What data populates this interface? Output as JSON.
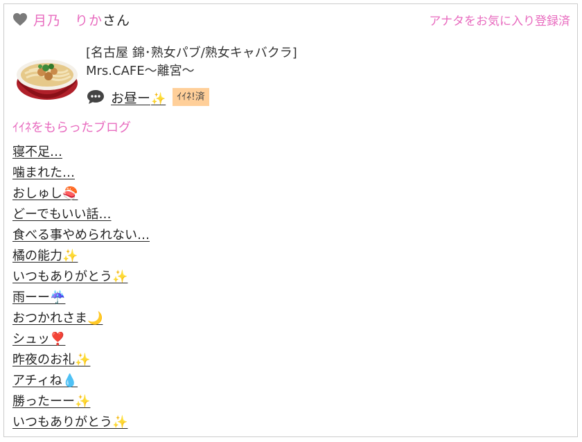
{
  "header": {
    "user_name": "月乃　りか",
    "name_suffix": "さん",
    "favorite_label": "アナタをお気に入り登録済"
  },
  "post": {
    "shop_line1": "[名古屋 錦･熟女パブ/熟女キャバクラ]",
    "shop_line2": "Mrs.CAFE〜離宮〜",
    "title": "お昼ー",
    "title_emoji": "✨",
    "liked_badge": "ｲｲﾈ!済"
  },
  "liked_blogs": {
    "heading": "ｲｲﾈをもらったブログ",
    "items": [
      "寝不足…",
      "噛まれた…",
      "おしゅし🍣",
      "どーでもいい話…",
      "食べる事やめられない…",
      "橘の能力✨",
      "いつもありがとう✨",
      "雨ーー☔️",
      "おつかれさま🌙",
      "シュッ❣️",
      "昨夜のお礼✨",
      "アチィね💧",
      "勝ったーー✨",
      "いつもありがとう✨"
    ]
  },
  "colors": {
    "accent": "#e86bbf",
    "badge_bg": "#ffcf99",
    "heart": "#7a7a7a"
  }
}
